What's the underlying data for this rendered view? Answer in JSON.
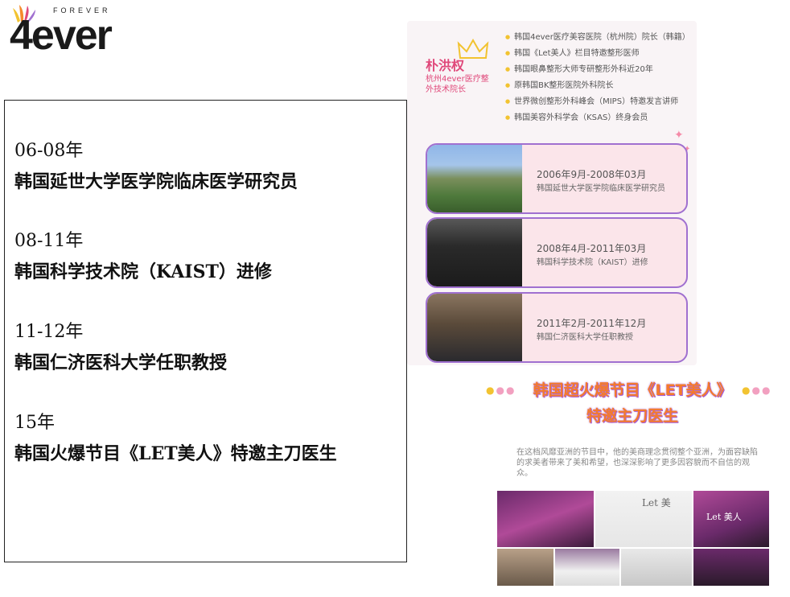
{
  "logo": {
    "tagline": "FOREVER",
    "wordmark": "4ever",
    "petal_colors": [
      "#f2c331",
      "#f58a2c",
      "#e0487a",
      "#a070d0"
    ]
  },
  "timeline": [
    {
      "year": "06-08年",
      "desc": "韩国延世大学医学院临床医学研究员"
    },
    {
      "year": "08-11年",
      "desc": "韩国科学技术院（KAIST）进修"
    },
    {
      "year": "11-12年",
      "desc": "韩国仁济医科大学任职教授"
    },
    {
      "year": "15年",
      "desc": "韩国火爆节目《LET美人》特邀主刀医生"
    }
  ],
  "profile": {
    "name": "朴洪权",
    "title": "杭州4ever医疗整外技术院长",
    "credentials": [
      "韩国4ever医疗美容医院（杭州院）院长（韩籍）",
      "韩国《Let美人》栏目特邀整形医师",
      "韩国眼鼻整形大师专研整形外科近20年",
      "原韩国BK整形医院外科院长",
      "世界微创整形外科峰会（MIPS）特邀发言讲师",
      "韩国美容外科学会（KSAS）终身会员"
    ]
  },
  "cards": [
    {
      "date": "2006年9月-2008年03月",
      "org": "韩国延世大学医学院临床医学研究员"
    },
    {
      "date": "2008年4月-2011年03月",
      "org": "韩国科学技术院（KAIST）进修"
    },
    {
      "date": "2011年2月-2011年12月",
      "org": "韩国仁济医科大学任职教授"
    }
  ],
  "show": {
    "title": "韩国超火爆节目《LET美人》",
    "subtitle": "特邀主刀医生",
    "description": "在这档风靡亚洲的节目中，他的美商理念贯彻整个亚洲，为面容缺陷的求美者带来了美和希望，也深深影响了更多因容貌而不自信的观众。",
    "gallery_text_1": "Let 美",
    "gallery_text_2": "Let 美人"
  },
  "colors": {
    "accent_pink": "#e0487a",
    "card_border": "#a070d0",
    "title_orange": "#f47a2c"
  }
}
